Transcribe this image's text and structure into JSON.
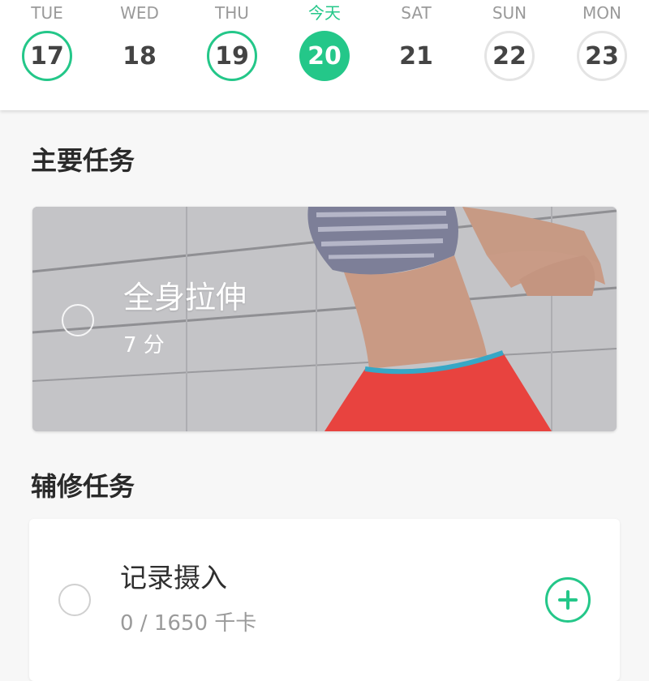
{
  "week": {
    "days": [
      {
        "dow": "TUE",
        "date": "17",
        "state": "done"
      },
      {
        "dow": "WED",
        "date": "18",
        "state": "none"
      },
      {
        "dow": "THU",
        "date": "19",
        "state": "done"
      },
      {
        "dow": "今天",
        "date": "20",
        "state": "today"
      },
      {
        "dow": "SAT",
        "date": "21",
        "state": "none"
      },
      {
        "dow": "SUN",
        "date": "22",
        "state": "future"
      },
      {
        "dow": "MON",
        "date": "23",
        "state": "future"
      }
    ]
  },
  "main_tasks": {
    "heading": "主要任务",
    "card": {
      "title": "全身拉伸",
      "duration": "7 分",
      "checked": false
    }
  },
  "aux_tasks": {
    "heading": "辅修任务",
    "card": {
      "title": "记录摄入",
      "progress": "0 / 1650 千卡",
      "checked": false,
      "add_icon": "plus-circle-icon"
    }
  },
  "colors": {
    "accent": "#24c789",
    "text_primary": "#2a2a2a",
    "text_secondary": "#9a9a9a",
    "background": "#f7f7f7"
  }
}
